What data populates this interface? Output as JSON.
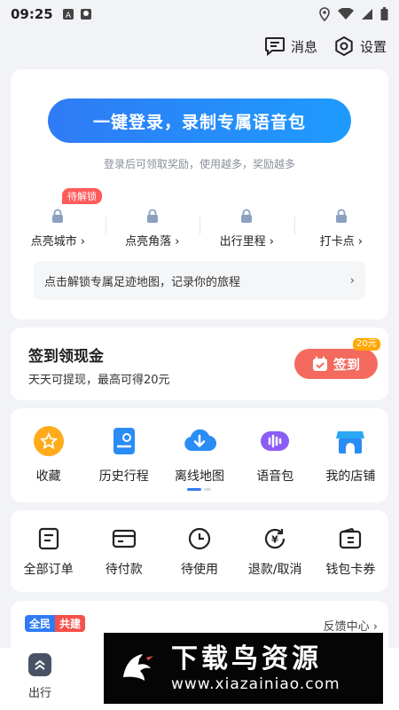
{
  "status_bar": {
    "time": "09:25"
  },
  "header": {
    "messages_label": "消息",
    "settings_label": "设置"
  },
  "login": {
    "button_label": "一键登录，录制专属语音包",
    "subtitle": "登录后可领取奖励，使用越多，奖励越多",
    "pending_badge": "待解锁",
    "items": [
      {
        "label": "点亮城市 ›"
      },
      {
        "label": "点亮角落 ›"
      },
      {
        "label": "出行里程 ›"
      },
      {
        "label": "打卡点 ›"
      }
    ],
    "footprint_text": "点击解锁专属足迹地图，记录你的旅程",
    "footprint_chevron": "›"
  },
  "checkin": {
    "title": "签到领现金",
    "subtitle": "天天可提现，最高可得20元",
    "button_label": "签到",
    "coin_badge": "20元"
  },
  "tools": [
    {
      "label": "收藏",
      "icon": "star-icon"
    },
    {
      "label": "历史行程",
      "icon": "history-icon"
    },
    {
      "label": "离线地图",
      "icon": "cloud-download-icon"
    },
    {
      "label": "语音包",
      "icon": "voice-icon"
    },
    {
      "label": "我的店铺",
      "icon": "store-icon"
    }
  ],
  "orders": [
    {
      "label": "全部订单",
      "icon": "order-list-icon"
    },
    {
      "label": "待付款",
      "icon": "card-icon"
    },
    {
      "label": "待使用",
      "icon": "clock-icon"
    },
    {
      "label": "退款/取消",
      "icon": "refund-icon"
    },
    {
      "label": "钱包卡券",
      "icon": "wallet-icon"
    }
  ],
  "community": {
    "badge_left": "全民",
    "badge_right": "共建",
    "feedback": "反馈中心 ›"
  },
  "bottom_nav": {
    "label": "出行"
  },
  "watermark": {
    "title": "下载鸟资源",
    "url": "www.xiazainiao.com"
  },
  "colors": {
    "primary": "#2f7bf5",
    "checkin": "#f56a5e",
    "badge": "#ff5b5b",
    "coin": "#ffa800"
  }
}
